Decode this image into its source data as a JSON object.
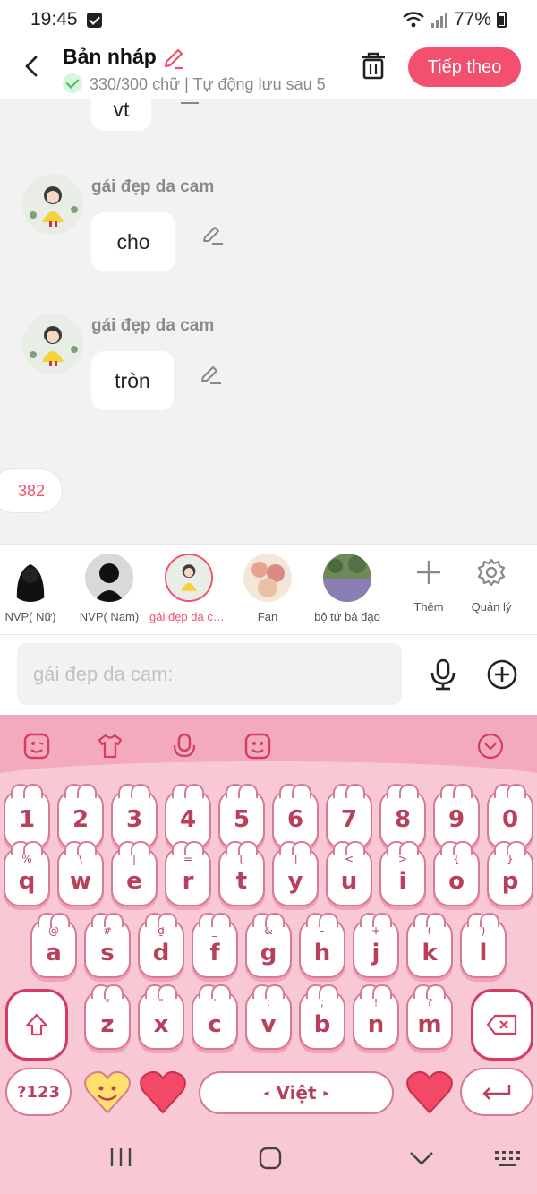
{
  "status": {
    "time": "19:45",
    "battery": "77%"
  },
  "header": {
    "title": "Bản nháp",
    "subtitle": "330/300 chữ | Tự động lưu sau 5",
    "next_button": "Tiếp theo"
  },
  "chat": {
    "messages": [
      {
        "text": "vt",
        "sender": ""
      },
      {
        "text": "cho",
        "sender": "gái đẹp da cam"
      },
      {
        "text": "tròn",
        "sender": "gái đẹp da cam"
      }
    ],
    "count_chip": "382"
  },
  "characters": [
    {
      "label": "NVP( Nữ)"
    },
    {
      "label": "NVP( Nam)"
    },
    {
      "label": "gái đẹp da cam",
      "selected": true
    },
    {
      "label": "Fan"
    },
    {
      "label": "bộ tứ bá đạo"
    },
    {
      "label": "Thêm"
    },
    {
      "label": "Quản lý"
    }
  ],
  "input": {
    "placeholder": "gái đẹp da cam:"
  },
  "keyboard": {
    "row_numbers": [
      "1",
      "2",
      "3",
      "4",
      "5",
      "6",
      "7",
      "8",
      "9",
      "0"
    ],
    "row1": [
      {
        "k": "q",
        "s": "%"
      },
      {
        "k": "w",
        "s": "\\"
      },
      {
        "k": "e",
        "s": "|"
      },
      {
        "k": "r",
        "s": "="
      },
      {
        "k": "t",
        "s": "["
      },
      {
        "k": "y",
        "s": "]"
      },
      {
        "k": "u",
        "s": "<"
      },
      {
        "k": "i",
        "s": ">"
      },
      {
        "k": "o",
        "s": "{"
      },
      {
        "k": "p",
        "s": "}"
      }
    ],
    "row2": [
      {
        "k": "a",
        "s": "@"
      },
      {
        "k": "s",
        "s": "#"
      },
      {
        "k": "d",
        "s": "₫"
      },
      {
        "k": "f",
        "s": "_"
      },
      {
        "k": "g",
        "s": "&"
      },
      {
        "k": "h",
        "s": "-"
      },
      {
        "k": "j",
        "s": "+"
      },
      {
        "k": "k",
        "s": "("
      },
      {
        "k": "l",
        "s": ")"
      }
    ],
    "row3": [
      {
        "k": "z",
        "s": "*"
      },
      {
        "k": "x",
        "s": "\""
      },
      {
        "k": "c",
        "s": "'"
      },
      {
        "k": "v",
        "s": ":"
      },
      {
        "k": "b",
        "s": ";"
      },
      {
        "k": "n",
        "s": "!"
      },
      {
        "k": "m",
        "s": "?"
      }
    ],
    "symbols_key": "?123",
    "space_label": "Việt"
  }
}
